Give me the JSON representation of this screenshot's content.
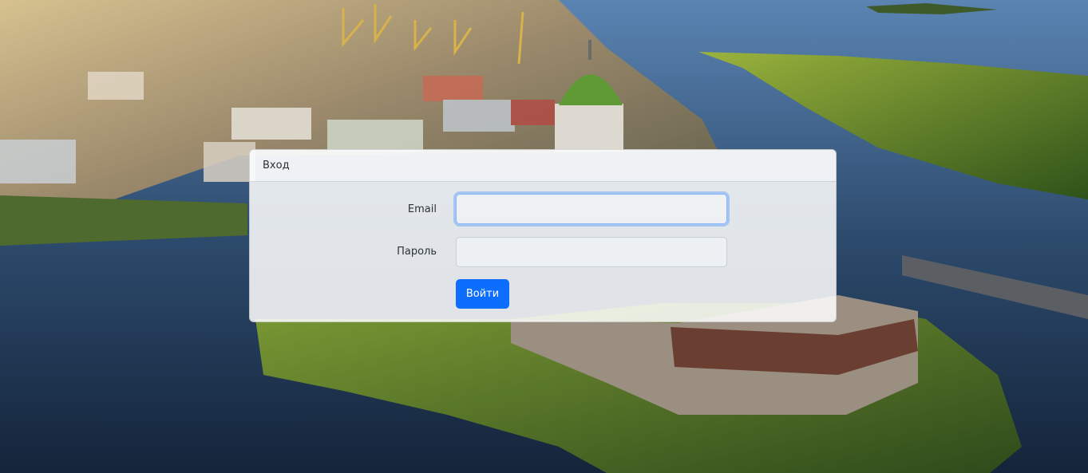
{
  "login": {
    "title": "Вход",
    "email_label": "Email",
    "email_value": "",
    "password_label": "Пароль",
    "password_value": "",
    "submit_label": "Войти"
  },
  "colors": {
    "primary": "#0d6efd",
    "focus_ring": "#86b7fe",
    "text": "#2d3237"
  }
}
